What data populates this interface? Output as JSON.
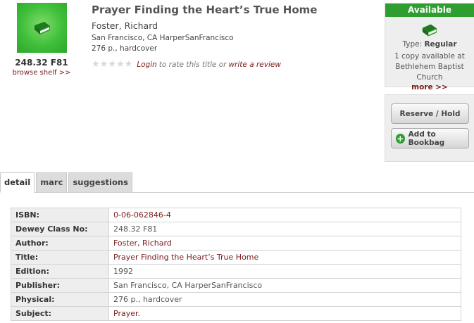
{
  "record": {
    "cover_icon": "book-icon",
    "call_number": "248.32 F81",
    "browse_link": "browse shelf >>",
    "title": "Prayer Finding the Heart’s True Home",
    "author": "Foster, Richard",
    "publication": "San Francisco, CA HarperSanFrancisco",
    "physical": "276 p., hardcover",
    "rating": {
      "stars": 0,
      "max_stars": 5,
      "login_link": "Login",
      "middle_text": "to rate this title or",
      "review_link": "write a review"
    }
  },
  "availability": {
    "status": "Available",
    "status_color": "#2e9e31",
    "type_label": "Type:",
    "type_value": "Regular",
    "copies_line1": "1 copy available at",
    "copies_line2": "Bethlehem Baptist Church",
    "more_link": "more >>"
  },
  "actions": {
    "reserve_label": "Reserve / Hold",
    "bookbag_label": "Add to Bookbag"
  },
  "tabs": [
    {
      "label": "detail",
      "active": true
    },
    {
      "label": "marc",
      "active": false
    },
    {
      "label": "suggestions",
      "active": false
    }
  ],
  "details": [
    {
      "label": "ISBN:",
      "value": "0-06-062846-4",
      "link": true
    },
    {
      "label": "Dewey Class No:",
      "value": "248.32 F81",
      "link": false
    },
    {
      "label": "Author:",
      "value": "Foster, Richard",
      "link": true
    },
    {
      "label": "Title:",
      "value": "Prayer Finding the Heart’s True Home",
      "link": true
    },
    {
      "label": "Edition:",
      "value": "1992",
      "link": false
    },
    {
      "label": "Publisher:",
      "value": "San Francisco, CA HarperSanFrancisco",
      "link": false
    },
    {
      "label": "Physical:",
      "value": "276 p., hardcover",
      "link": false
    },
    {
      "label": "Subject:",
      "value": "Prayer.",
      "link": true
    }
  ],
  "colors": {
    "link": "#7a1b1b",
    "accent_green": "#2e9e31"
  }
}
